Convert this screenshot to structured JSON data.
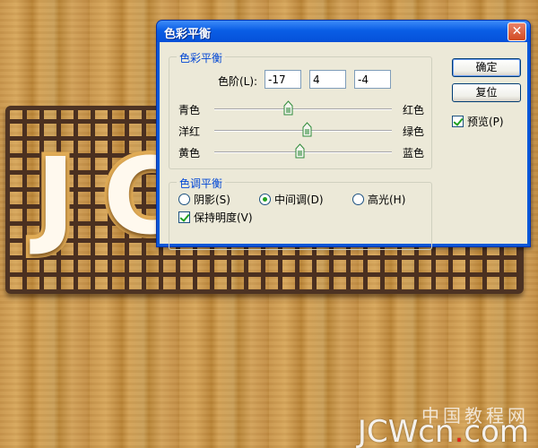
{
  "dialog": {
    "title": "色彩平衡",
    "close_symbol": "✕",
    "color_balance_group": {
      "label": "色彩平衡",
      "levels_label": "色阶(L):",
      "levels": [
        "-17",
        "4",
        "-4"
      ],
      "sliders": [
        {
          "left": "青色",
          "right": "红色",
          "value": -17
        },
        {
          "left": "洋红",
          "right": "绿色",
          "value": 4
        },
        {
          "left": "黄色",
          "right": "蓝色",
          "value": -4
        }
      ],
      "slider_range": [
        -100,
        100
      ]
    },
    "tone_balance_group": {
      "label": "色调平衡",
      "shadows": "阴影(S)",
      "midtones": "中间调(D)",
      "highlights": "高光(H)",
      "selected": "midtones",
      "preserve_luminosity": "保持明度(V)",
      "preserve_luminosity_checked": true
    },
    "buttons": {
      "ok": "确定",
      "reset": "复位"
    },
    "preview": {
      "label": "预览(P)",
      "checked": true
    }
  },
  "canvas": {
    "cookie_letters": [
      "J",
      "C"
    ]
  },
  "watermark": {
    "chinese": "中国教程网",
    "latin_a": "JCWcn",
    "dot": ".",
    "latin_b": "com"
  },
  "colors": {
    "title_bar": "#0a5ee6",
    "dialog_face": "#ece9d8",
    "group_label": "#0046d5",
    "thumb_green": "#2e8b3a"
  }
}
